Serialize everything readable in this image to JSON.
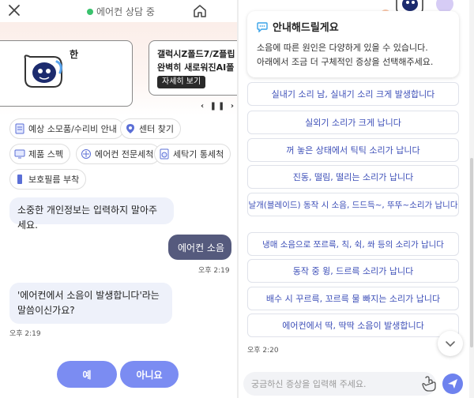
{
  "header": {
    "status": "에어컨 상담 중"
  },
  "banner": {
    "card1_text": "한",
    "card2_line1": "갤럭시Z폴드7/Z플립",
    "card2_line2": "완벽히 새로워진AI폴",
    "detail_label": "자세히 보기",
    "pager": "‹ ❚❚ ›"
  },
  "chips": [
    {
      "label": "예상 소모품/수리비 안내",
      "icon": "receipt-icon"
    },
    {
      "label": "센터 찾기",
      "icon": "location-pin-icon"
    },
    {
      "label": "제품 스펙",
      "icon": "monitor-spec-icon"
    },
    {
      "label": "에어컨 전문세척",
      "icon": "aircon-clean-icon"
    },
    {
      "label": "세탁기 통세척",
      "icon": "washer-icon"
    },
    {
      "label": "보호필름 부착",
      "icon": "phone-film-icon"
    }
  ],
  "chat": {
    "notice": "소중한 개인정보는 입력하지 말아주세요.",
    "user_msg": "에어컨 소음",
    "user_time": "오후 2:19",
    "bot_question_line1": "'에어컨에서 소음이 발생합니다'라는",
    "bot_question_line2": "말씀이신가요?",
    "bot_time": "오후 2:19",
    "yes_label": "예",
    "no_label": "아니요"
  },
  "guide": {
    "title": "안내해드릴게요",
    "body_line1": "소음에 따른 원인은 다양하게 있을 수 있습니다.",
    "body_line2": "아래에서 조금 더 구체적인 증상을 선택해주세요."
  },
  "options": [
    "실내기 소리 남, 실내기 소리 크게 발생합니다",
    "실외기 소리가 크게 납니다",
    "꺼 놓은 상태에서 틱틱 소리가 납니다",
    "진동, 떨림, 떨리는 소리가 납니다",
    "날개(블레이드) 동작 시 소음, 드드득~, 뚜뚜~소리가 납니다",
    "냉매 소음으로 쪼르륵, 칙, 쉭, 쏴 등의 소리가 납니다",
    "동작 중 윙, 드르륵 소리가 납니다",
    "배수 시 꾸르륵, 꼬르륵 물 빠지는 소리가 납니다",
    "에어컨에서 딱, 딱딱 소음이 발생합니다"
  ],
  "right_time": "오후 2:20",
  "input": {
    "placeholder": "궁금하신 증상을 입력해 주세요."
  },
  "colors": {
    "accent": "#7b8cf2",
    "user_bubble": "#555a7d",
    "bot_bubble": "#eef1fa",
    "option_text": "#3d4fb8",
    "status_dot": "#3ac26d"
  }
}
